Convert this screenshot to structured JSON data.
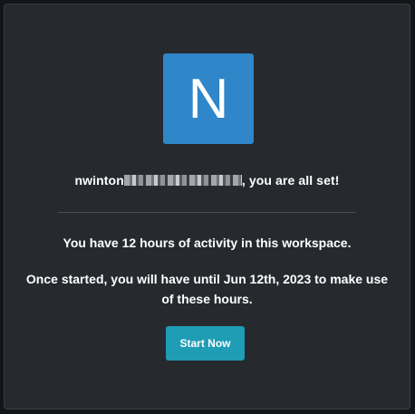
{
  "logo": {
    "letter": "N",
    "color": "#2f86c9"
  },
  "greeting": {
    "username": "nwinton",
    "redacted": true,
    "suffix": ", you are all set!"
  },
  "activity_text": "You have 12 hours of activity in this workspace.",
  "deadline_text": "Once started, you will have until Jun 12th, 2023 to make use of these hours.",
  "start_button": {
    "label": "Start Now",
    "color": "#1e9db5"
  }
}
